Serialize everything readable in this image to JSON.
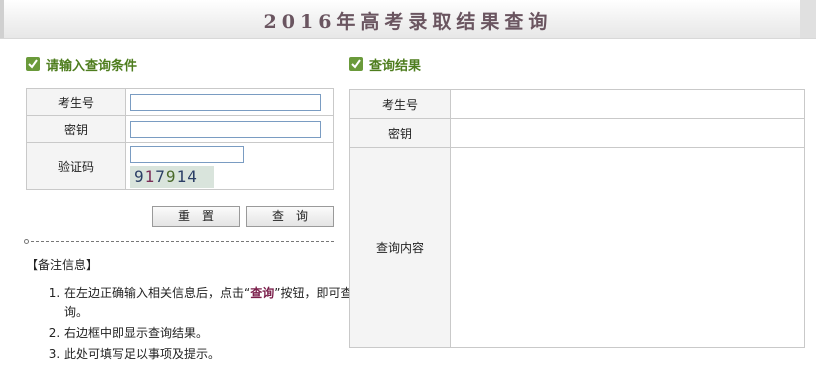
{
  "header": {
    "title": "2016年高考录取结果查询"
  },
  "query_panel": {
    "heading": "请输入查询条件",
    "fields": [
      {
        "label": "考生号",
        "value": "",
        "placeholder": ""
      },
      {
        "label": "密钥",
        "value": "",
        "placeholder": ""
      },
      {
        "label": "验证码",
        "value": "",
        "placeholder": ""
      }
    ],
    "captcha_text": [
      "9",
      "1",
      "7",
      "9",
      "1",
      "4"
    ],
    "reset_label": "重置",
    "submit_label": "查询"
  },
  "notes": {
    "title": "【备注信息】",
    "items": [
      {
        "pre": "在左边正确输入相关信息后，点击“",
        "em": "查询",
        "post": "”按钮，即可查询。"
      },
      {
        "pre": "右边框中即显示查询结果。",
        "em": "",
        "post": ""
      },
      {
        "pre": "此处可填写足以事项及提示。",
        "em": "",
        "post": ""
      }
    ]
  },
  "result_panel": {
    "heading": "查询结果",
    "rows": [
      {
        "label": "考生号",
        "value": ""
      },
      {
        "label": "密钥",
        "value": ""
      },
      {
        "label": "查询内容",
        "value": ""
      }
    ]
  },
  "colors": {
    "accent_green": "#4e7d1e",
    "title": "#6a5560",
    "emphasis": "#7a1e4a"
  }
}
